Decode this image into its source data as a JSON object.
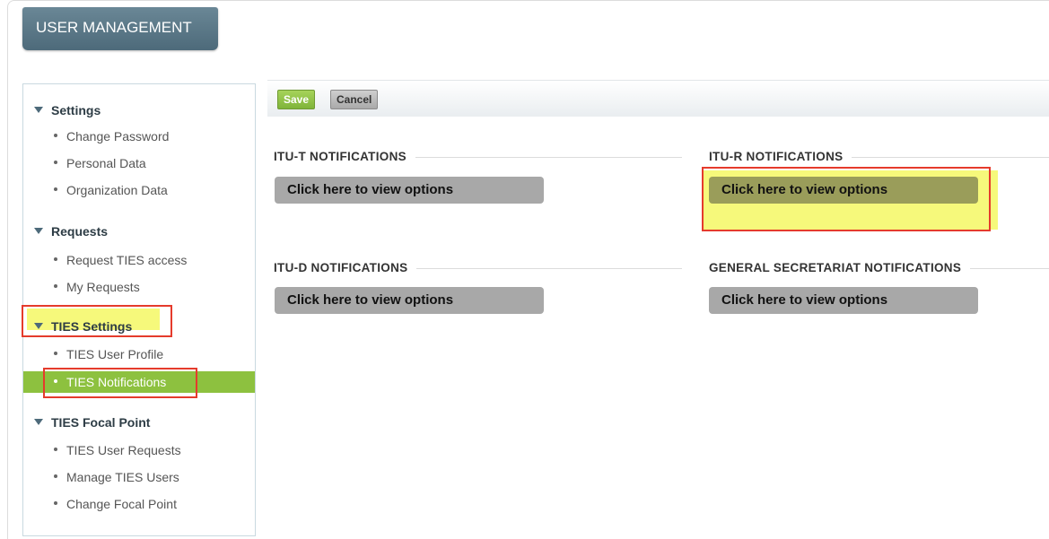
{
  "app": {
    "title": "USER MANAGEMENT"
  },
  "toolbar": {
    "save_label": "Save",
    "cancel_label": "Cancel"
  },
  "sidebar": {
    "sections": [
      {
        "title": "Settings",
        "items": [
          "Change Password",
          "Personal Data",
          "Organization Data"
        ]
      },
      {
        "title": "Requests",
        "items": [
          "Request TIES access",
          "My Requests"
        ]
      },
      {
        "title": "TIES Settings",
        "items": [
          "TIES User Profile",
          "TIES Notifications"
        ]
      },
      {
        "title": "TIES Focal Point",
        "items": [
          "TIES User Requests",
          "Manage TIES Users",
          "Change Focal Point"
        ]
      }
    ],
    "active_item": "TIES Notifications"
  },
  "notifications": [
    {
      "label": "ITU-T NOTIFICATIONS",
      "button": "Click here to view options"
    },
    {
      "label": "ITU-R NOTIFICATIONS",
      "button": "Click here to view options"
    },
    {
      "label": "ITU-D NOTIFICATIONS",
      "button": "Click here to view options"
    },
    {
      "label": "GENERAL SECRETARIAT NOTIFICATIONS",
      "button": "Click here to view options"
    }
  ],
  "colors": {
    "accent_green": "#8dc13f",
    "highlight_red": "#e53b2c",
    "highlight_yellow": "#f6f97b",
    "title_bar": "#4d6a7a"
  }
}
